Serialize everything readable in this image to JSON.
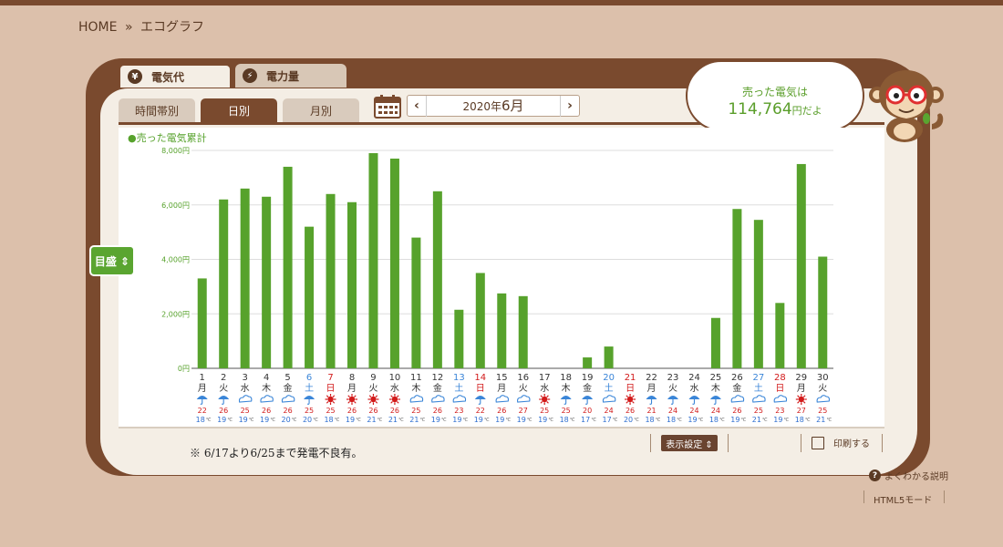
{
  "breadcrumb": {
    "home": "HOME",
    "sep": "»",
    "current": "エコグラフ"
  },
  "tabs": {
    "cost": "電気代",
    "power": "電力量",
    "cost_icon": "¥",
    "power_icon": "⚡"
  },
  "subtabs": {
    "hour": "時間帯別",
    "day": "日別",
    "month": "月別"
  },
  "month_nav": {
    "prev": "‹",
    "year": "2020年",
    "month": "6月",
    "next": "›"
  },
  "bubble": {
    "line1": "売った電気は",
    "amount": "114,764",
    "suffix": "円だよ"
  },
  "scale_button": "目盛 ⇕",
  "note": "※ 6/17より6/25まで発電不良有。",
  "display_settings": "表示設定 ⇕",
  "print": "印刷する",
  "help": "よくわかる説明",
  "help_icon": "?",
  "html5": "HTML5モード",
  "colors": {
    "bar": "#57a22c",
    "weekday": "#333333",
    "saturday": "#3b86d8",
    "sunday": "#d21b1b",
    "high": "#d21b1b",
    "low": "#2f6fd0",
    "brown": "#7a4a2e"
  },
  "chart_data": {
    "type": "bar",
    "title": "●売った電気累計",
    "yunit": "円",
    "ylim": [
      0,
      8000
    ],
    "yticks": [
      "0円",
      "2,000円",
      "4,000円",
      "6,000円",
      "8,000円"
    ],
    "ytick_values": [
      0,
      2000,
      4000,
      6000,
      8000
    ],
    "days": [
      "1",
      "2",
      "3",
      "4",
      "5",
      "6",
      "7",
      "8",
      "9",
      "10",
      "11",
      "12",
      "13",
      "14",
      "15",
      "16",
      "17",
      "18",
      "19",
      "20",
      "21",
      "22",
      "23",
      "24",
      "25",
      "26",
      "27",
      "28",
      "29",
      "30"
    ],
    "weekdays": [
      "月",
      "火",
      "水",
      "木",
      "金",
      "土",
      "日",
      "月",
      "火",
      "水",
      "木",
      "金",
      "土",
      "日",
      "月",
      "火",
      "水",
      "木",
      "金",
      "土",
      "日",
      "月",
      "火",
      "水",
      "木",
      "金",
      "土",
      "日",
      "月",
      "火"
    ],
    "values": [
      3300,
      6200,
      6600,
      6300,
      7400,
      5200,
      6400,
      6100,
      7900,
      7700,
      4800,
      6500,
      2150,
      3500,
      2750,
      2650,
      0,
      0,
      400,
      800,
      0,
      0,
      0,
      0,
      1850,
      5850,
      5450,
      2400,
      7500,
      4100
    ],
    "weather": [
      "umbrella",
      "umbrella",
      "cloud",
      "cloud",
      "cloud",
      "umbrella",
      "sun",
      "sun",
      "sun",
      "sun",
      "cloud",
      "cloud",
      "cloud",
      "umbrella",
      "cloud",
      "cloud",
      "sun",
      "umbrella",
      "umbrella",
      "cloud",
      "sun",
      "umbrella",
      "umbrella",
      "umbrella",
      "umbrella",
      "cloud",
      "cloud",
      "cloud",
      "sun",
      "cloud"
    ],
    "high_temps": [
      "22",
      "26",
      "25",
      "26",
      "26",
      "25",
      "25",
      "26",
      "26",
      "26",
      "25",
      "26",
      "23",
      "22",
      "26",
      "27",
      "25",
      "25",
      "20",
      "24",
      "26",
      "21",
      "24",
      "24",
      "24",
      "26",
      "25",
      "23",
      "27",
      "25"
    ],
    "low_temps": [
      "18",
      "19",
      "19",
      "19",
      "20",
      "20",
      "18",
      "19",
      "21",
      "21",
      "21",
      "19",
      "19",
      "19",
      "19",
      "19",
      "19",
      "18",
      "17",
      "17",
      "20",
      "18",
      "18",
      "19",
      "18",
      "19",
      "21",
      "19",
      "18",
      "21"
    ],
    "temp_unit": "℃"
  }
}
